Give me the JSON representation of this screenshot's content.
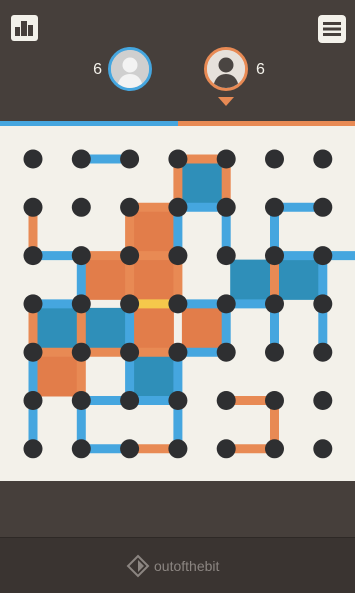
{
  "players": {
    "blue": {
      "score": "6",
      "color": "#45a6df"
    },
    "orange": {
      "score": "6",
      "color": "#e88a54",
      "is_current_turn": true
    }
  },
  "colors": {
    "dot": "#2e2f31",
    "board_bg": "#f3f1ea",
    "blue_line": "#45a6df",
    "orange_line": "#e88a54",
    "blue_box": "#2f8fb9",
    "orange_box": "#e27d4a",
    "highlight_line": "#f5c84b"
  },
  "progress": {
    "blue_fraction": 0.5
  },
  "board": {
    "rows": 7,
    "cols": 7,
    "h_lines": [
      [
        1,
        0,
        "b"
      ],
      [
        3,
        0,
        "o"
      ],
      [
        2,
        1,
        "o"
      ],
      [
        3,
        1,
        "b"
      ],
      [
        5,
        1,
        "b"
      ],
      [
        0,
        2,
        "b"
      ],
      [
        1,
        2,
        "o"
      ],
      [
        2,
        3,
        "o"
      ],
      [
        3,
        3,
        "b"
      ],
      [
        0,
        3,
        "b"
      ],
      [
        4,
        3,
        "b"
      ],
      [
        0,
        4,
        "o"
      ],
      [
        1,
        4,
        "o"
      ],
      [
        2,
        4,
        "o"
      ],
      [
        3,
        4,
        "b"
      ],
      [
        1,
        5,
        "b"
      ],
      [
        2,
        5,
        "b"
      ],
      [
        4,
        5,
        "o"
      ],
      [
        1,
        6,
        "b"
      ],
      [
        2,
        6,
        "o"
      ],
      [
        5,
        2,
        "b"
      ],
      [
        6,
        2,
        "b"
      ],
      [
        2,
        2,
        "o"
      ],
      [
        4,
        6,
        "o"
      ],
      [
        4,
        7,
        "b"
      ]
    ],
    "v_lines": [
      [
        3,
        0,
        "o"
      ],
      [
        4,
        0,
        "o"
      ],
      [
        0,
        1,
        "o"
      ],
      [
        2,
        1,
        "o"
      ],
      [
        3,
        1,
        "b"
      ],
      [
        5,
        1,
        "b"
      ],
      [
        1,
        2,
        "b"
      ],
      [
        2,
        2,
        "o"
      ],
      [
        3,
        2,
        "o"
      ],
      [
        5,
        2,
        "o"
      ],
      [
        6,
        2,
        "b"
      ],
      [
        4,
        1,
        "b"
      ],
      [
        0,
        3,
        "o"
      ],
      [
        1,
        3,
        "o"
      ],
      [
        2,
        3,
        "b"
      ],
      [
        4,
        3,
        "b"
      ],
      [
        5,
        3,
        "b"
      ],
      [
        6,
        3,
        "b"
      ],
      [
        0,
        4,
        "b"
      ],
      [
        1,
        4,
        "o"
      ],
      [
        2,
        4,
        "b"
      ],
      [
        3,
        4,
        "b"
      ],
      [
        1,
        5,
        "b"
      ],
      [
        5,
        5,
        "o"
      ],
      [
        0,
        5,
        "b"
      ],
      [
        3,
        5,
        "b"
      ]
    ],
    "boxes": [
      [
        3,
        0,
        "b"
      ],
      [
        2,
        1,
        "o"
      ],
      [
        1,
        2,
        "o"
      ],
      [
        2,
        2,
        "o"
      ],
      [
        4,
        2,
        "b"
      ],
      [
        5,
        2,
        "b"
      ],
      [
        0,
        3,
        "b"
      ],
      [
        1,
        3,
        "b"
      ],
      [
        2,
        3,
        "o"
      ],
      [
        3,
        3,
        "o"
      ],
      [
        0,
        4,
        "o"
      ],
      [
        2,
        4,
        "b"
      ]
    ],
    "highlight": [
      2,
      3
    ]
  },
  "footer": {
    "brand": "outofthebit"
  }
}
